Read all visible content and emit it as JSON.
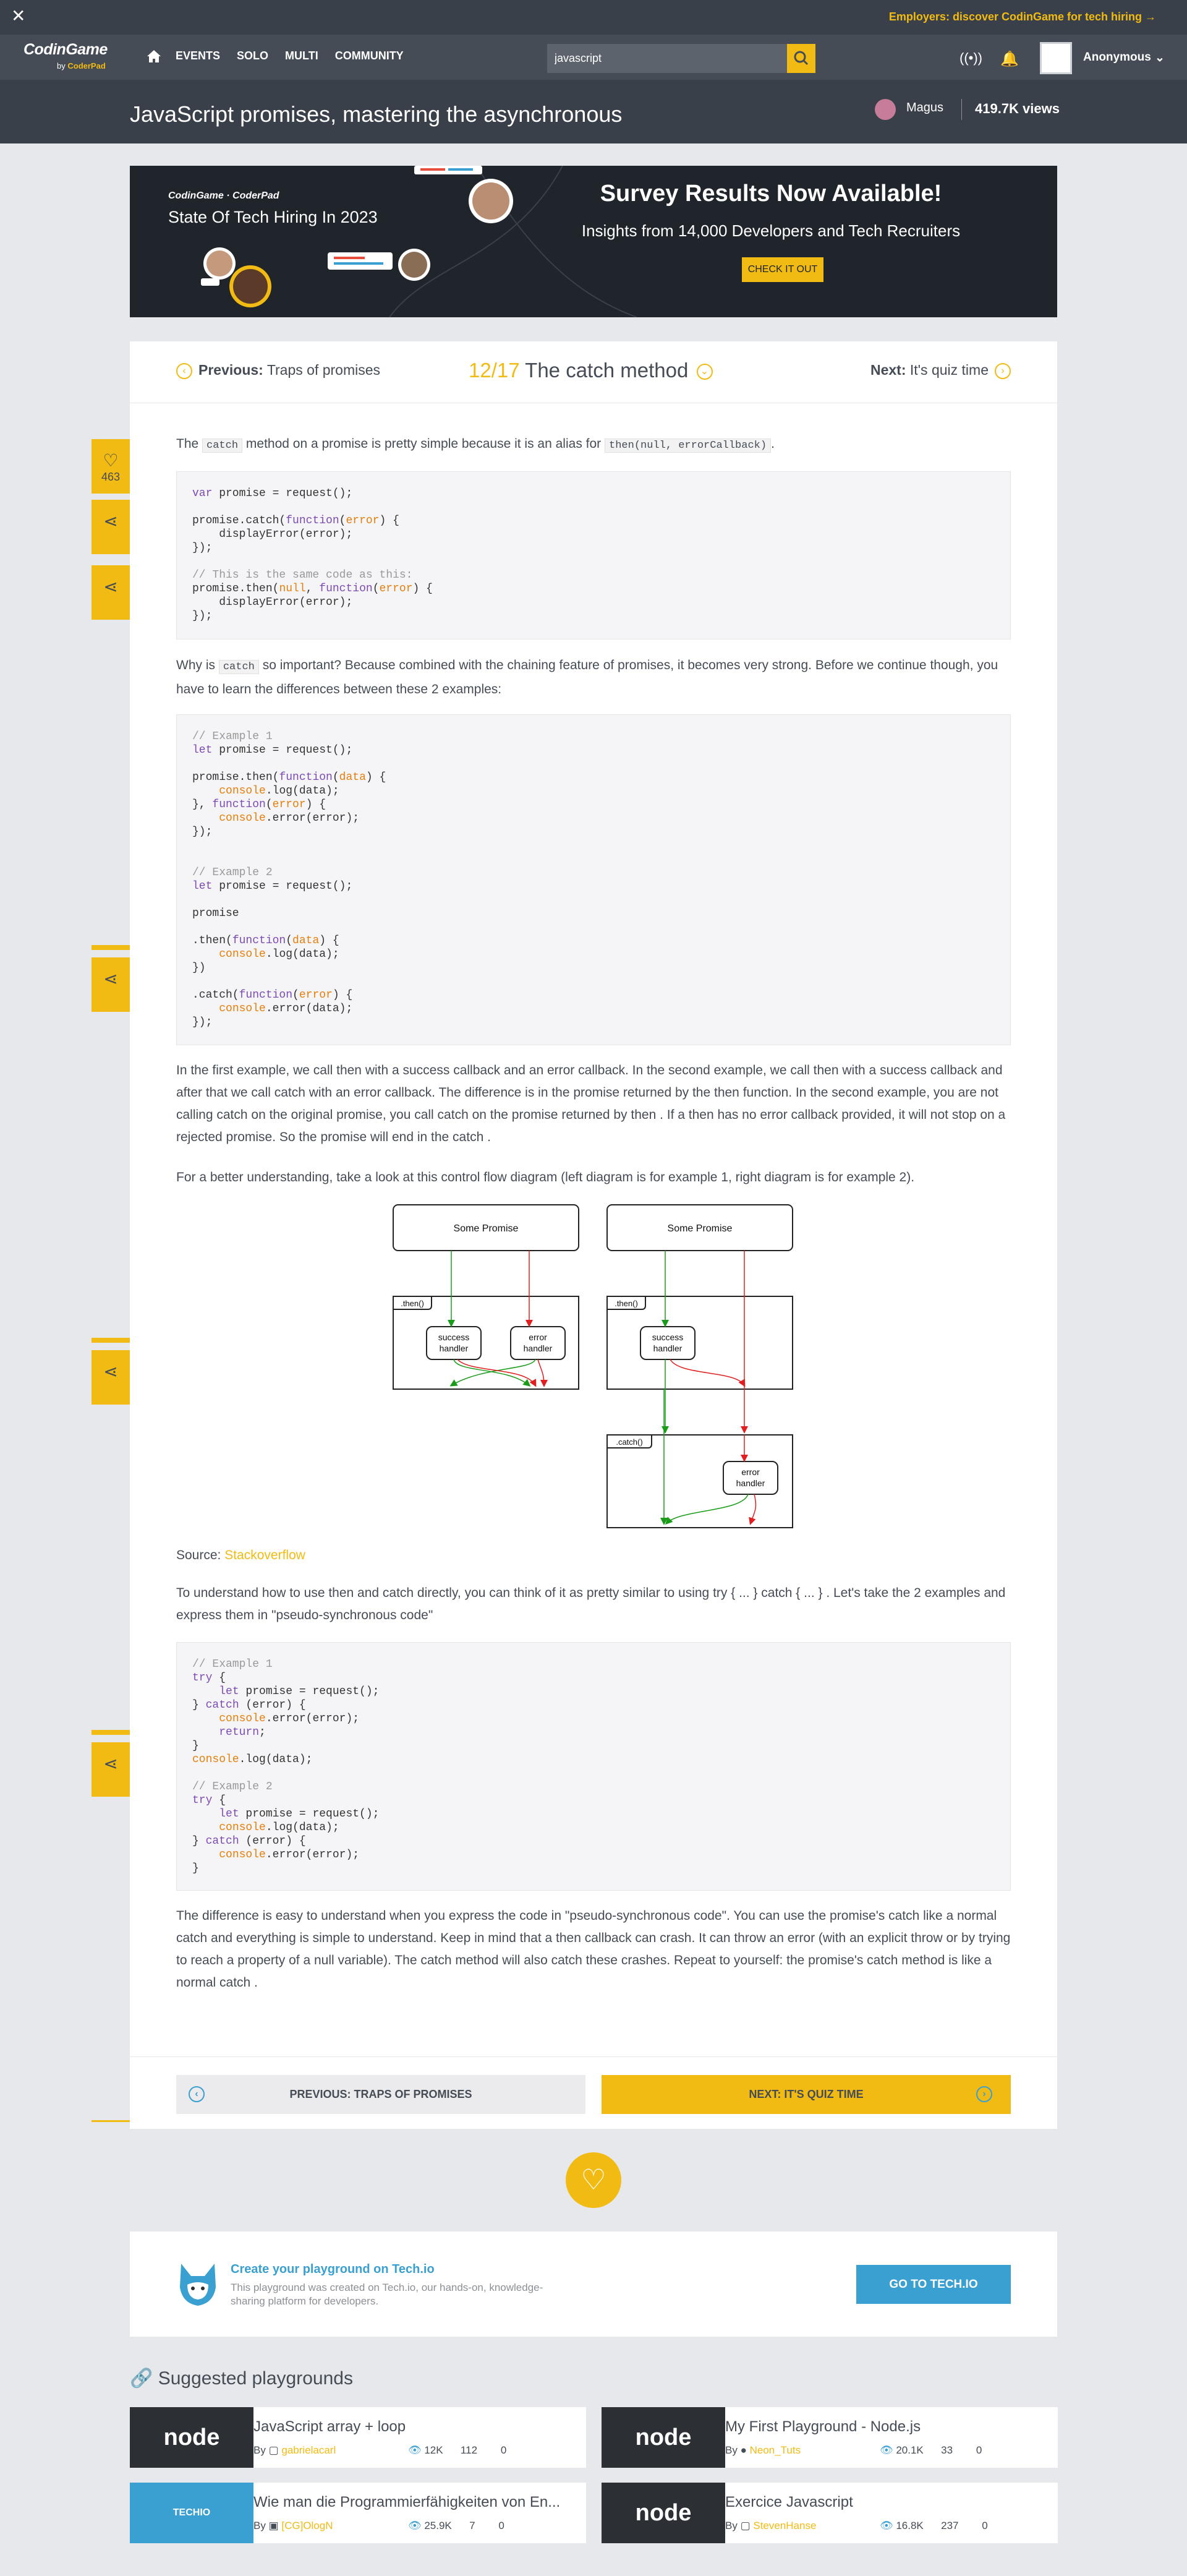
{
  "topbar": {
    "close": "✕",
    "employers": "Employers: discover CodinGame for tech hiring →"
  },
  "nav": {
    "logo_main": "CodinGame",
    "logo_by": "by",
    "logo_sub": "CoderPad",
    "items": [
      "EVENTS",
      "SOLO",
      "MULTI",
      "COMMUNITY"
    ],
    "search_value": "javascript",
    "user": "Anonymous"
  },
  "header": {
    "title": "JavaScript promises, mastering the asynchronous",
    "author": "Magus",
    "views": "419.7K views"
  },
  "banner": {
    "brand": "CodinGame · CoderPad",
    "subtitle": "State Of Tech Hiring In 2023",
    "headline": "Survey Results Now Available!",
    "tagline": "Insights from 14,000 Developers and Tech Recruiters",
    "cta": "CHECK IT OUT"
  },
  "pager": {
    "prev_label": "Previous:",
    "prev_title": "Traps of promises",
    "page": "12/17",
    "title": "The catch method",
    "next_label": "Next:",
    "next_title": "It's quiz time"
  },
  "side": {
    "likes": "463"
  },
  "p1": {
    "a": "The",
    "c1": "catch",
    "b": "method on a promise is pretty simple because it is an alias for",
    "c2": "then(null, errorCallback)",
    "d": "."
  },
  "p2": {
    "a": "Why is",
    "c1": "catch",
    "b": "so important? Because combined with the chaining feature of promises, it becomes very strong. Before we continue though, you have to learn the differences between these 2 examples:"
  },
  "p3": "In the first example, we call then with a success callback and an error callback. In the second example, we call then with a success callback and after that we call catch with an error callback. The difference is in the promise returned by the then function. In the second example, you are not calling catch on the original promise, you call catch on the promise returned by then . If a then has no error callback provided, it will not stop on a rejected promise. So the promise will end in the catch .",
  "p4": "For a better understanding, take a look at this control flow diagram (left diagram is for example 1, right diagram is for example 2).",
  "diagram": {
    "some_promise": "Some Promise",
    "then": ".then()",
    "catch": ".catch()",
    "success": "success",
    "handler": "handler",
    "error": "error"
  },
  "source": {
    "label": "Source:",
    "link": "Stackoverflow"
  },
  "p5": "To understand how to use then and catch directly, you can think of it as pretty similar to using try { ... } catch { ... } . Let's take the 2 examples and express them in \"pseudo-synchronous code\"",
  "p6": "The difference is easy to understand when you express the code in \"pseudo-synchronous code\". You can use the promise's catch like a normal catch and everything is simple to understand. Keep in mind that a then callback can crash. It can throw an error (with an explicit throw or by trying to reach a property of a null variable). The catch method will also catch these crashes. Repeat to yourself: the promise's catch method is like a normal catch .",
  "buttons": {
    "prev": "PREVIOUS: TRAPS OF PROMISES",
    "next": "NEXT: IT'S QUIZ TIME"
  },
  "promo": {
    "title": "Create your playground on Tech.io",
    "desc": "This playground was created on Tech.io, our hands-on, knowledge-sharing platform for developers.",
    "button": "GO TO TECH.IO"
  },
  "suggested": {
    "title": "Suggested playgrounds",
    "items": [
      {
        "name": "JavaScript array + loop",
        "by": "By",
        "author": "gabrielacarl",
        "views": "12K",
        "a": "112",
        "b": "0",
        "thumb": "node"
      },
      {
        "name": "My First Playground - Node.js",
        "by": "By",
        "author": "Neon_Tuts",
        "views": "20.1K",
        "a": "33",
        "b": "0",
        "thumb": "node"
      },
      {
        "name": "Wie man die Programmierfähigkeiten von En...",
        "by": "By",
        "author": "[CG]OlogN",
        "views": "25.9K",
        "a": "7",
        "b": "0",
        "thumb": "TECHIO"
      },
      {
        "name": "Exercice Javascript",
        "by": "By",
        "author": "StevenHanse",
        "views": "16.8K",
        "a": "237",
        "b": "0",
        "thumb": "node"
      }
    ]
  }
}
